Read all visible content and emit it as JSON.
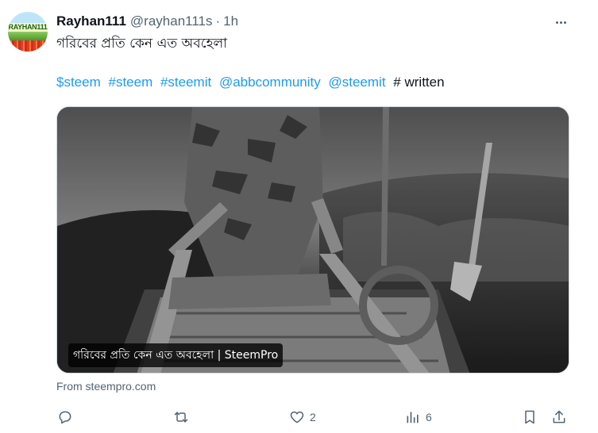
{
  "tweet": {
    "display_name": "Rayhan111",
    "handle": "@rayhan111s",
    "separator": "·",
    "time": "1h",
    "avatar_text": "RAYHAN111",
    "text": "গরিবের প্রতি কেন এত অবহেলা",
    "tags": [
      "$steem",
      "#steem",
      "#steemit",
      "@abbcommunity",
      "@steemit"
    ],
    "tail_text": "# written",
    "media": {
      "caption": "গরিবের প্রতি কেন এত অবহেলা | SteemPro"
    },
    "source": "From steempro.com",
    "actions": {
      "reply_icon": "reply-icon",
      "retweet_icon": "retweet-icon",
      "like_icon": "heart-icon",
      "like_count": "2",
      "views_icon": "analytics-icon",
      "views_count": "6",
      "bookmark_icon": "bookmark-icon",
      "share_icon": "share-icon"
    }
  },
  "colors": {
    "link": "#1d9bf0",
    "muted": "#536471",
    "text": "#0f1419",
    "border": "#cfd9de"
  }
}
